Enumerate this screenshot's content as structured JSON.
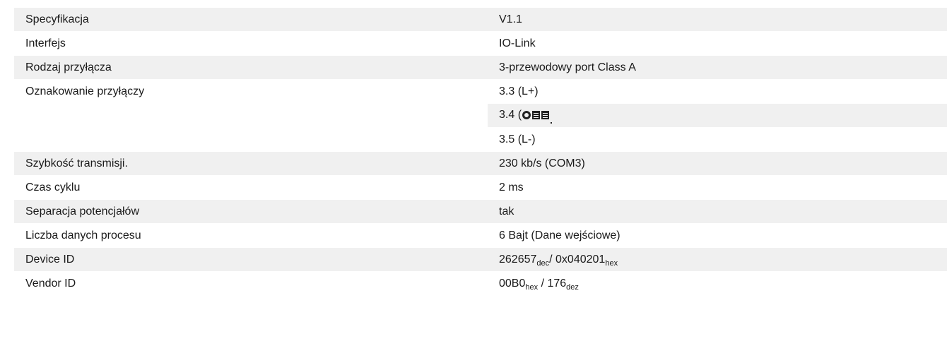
{
  "rows": [
    {
      "label": "Specyfikacja",
      "value": "V1.1"
    },
    {
      "label": "Interfejs",
      "value": "IO-Link"
    },
    {
      "label": "Rodzaj przyłącza",
      "value": "3-przewodowy port Class A"
    },
    {
      "label": "Oznakowanie przyłączy",
      "values": [
        "3.3 (L+)",
        "3.4 (",
        "3.5 (L-)"
      ]
    },
    {
      "label": "Szybkość transmisji.",
      "value": "230 kb/s (COM3)"
    },
    {
      "label": "Czas cyklu",
      "value": "2 ms"
    },
    {
      "label": "Separacja potencjałów",
      "value": "tak"
    },
    {
      "label": "Liczba danych procesu",
      "value": "6 Bajt (Dane wejściowe)"
    },
    {
      "label": "Device ID",
      "value_parts": [
        "262657",
        "dec",
        "/ 0x040201",
        "hex"
      ]
    },
    {
      "label": "Vendor ID",
      "value_parts": [
        "00B0",
        "hex",
        " / 176",
        "dez"
      ]
    }
  ]
}
